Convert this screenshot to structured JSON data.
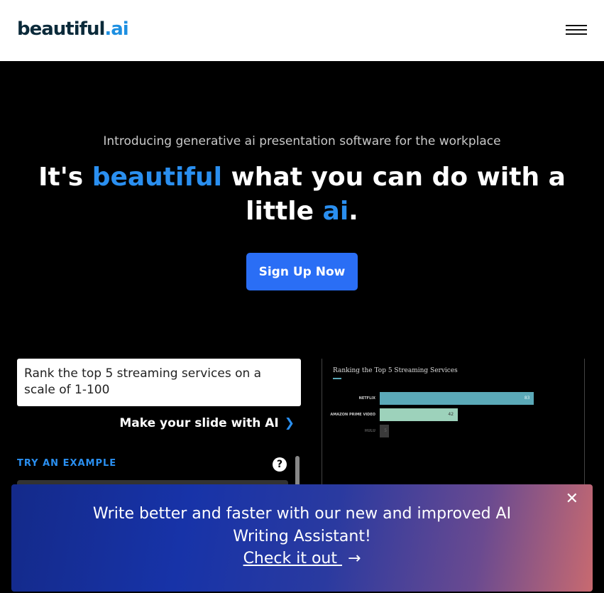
{
  "header": {
    "logo_main": "beautiful",
    "logo_dot": ".",
    "logo_ai": "ai",
    "menu_icon": "hamburger-icon"
  },
  "hero": {
    "intro": "Introducing generative ai presentation software for the workplace",
    "headline_pre": "It's ",
    "headline_blue1": "beautiful",
    "headline_mid": " what you can do with a little ",
    "headline_blue2": "ai",
    "headline_end": ".",
    "signup_label": "Sign Up Now"
  },
  "generator": {
    "prompt": "Rank the top 5 streaming services on a scale of 1-100",
    "make_label": "Make your slide with AI",
    "make_icon": "chevron-right-icon",
    "try_label": "TRY AN EXAMPLE",
    "help_icon": "?"
  },
  "chart_data": {
    "type": "bar",
    "orientation": "horizontal",
    "title": "Ranking the Top 5 Streaming Services",
    "categories": [
      "NETFLIX",
      "AMAZON PRIME VIDEO",
      "HULU"
    ],
    "values": [
      83,
      42,
      5
    ],
    "colors": [
      "#5ba9b8",
      "#9dd2bb",
      "#3a3a3a"
    ]
  },
  "banner": {
    "text": "Write better and faster with our new and improved AI Writing Assistant!",
    "link": "Check it out",
    "link_icon": "arrow-right-icon",
    "close_icon": "close-icon"
  },
  "colors": {
    "accent": "#2a8ff0",
    "button": "#2a6ef5"
  }
}
